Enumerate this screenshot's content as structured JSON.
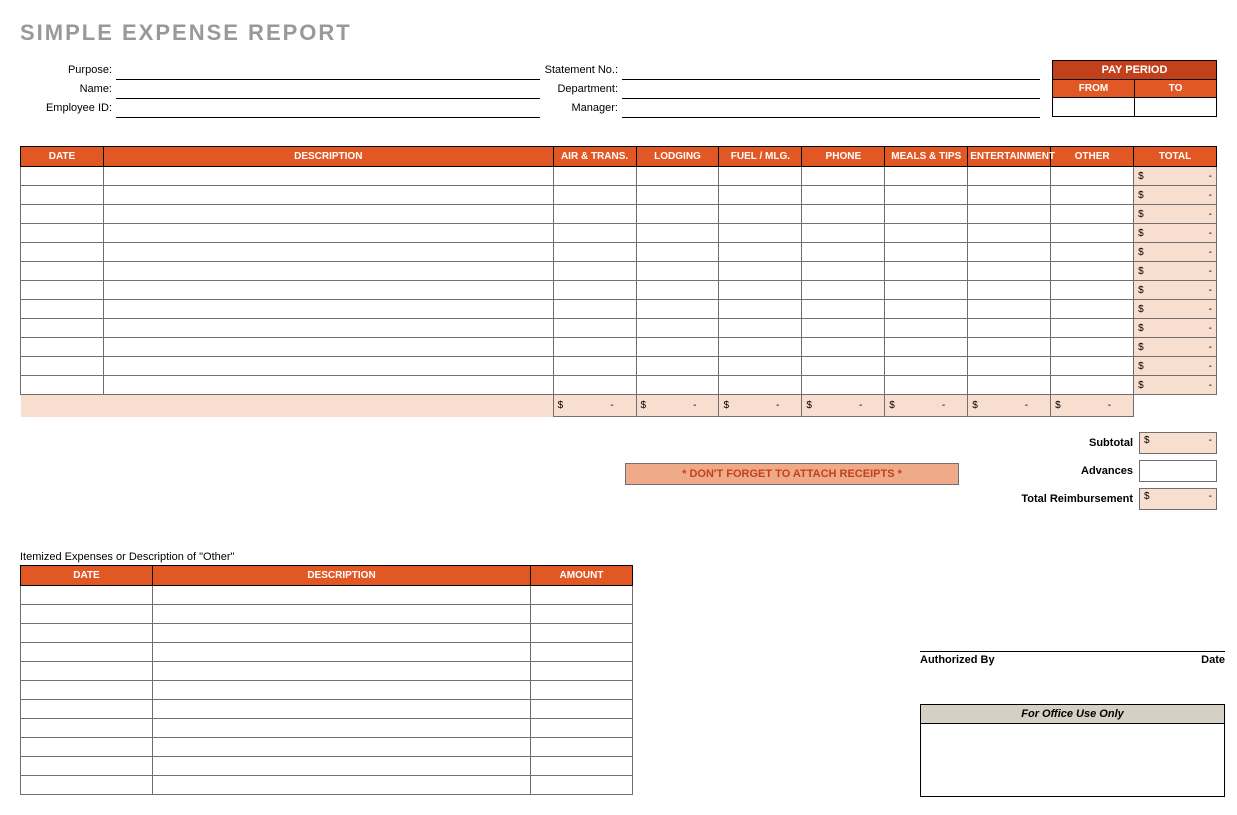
{
  "title": "SIMPLE EXPENSE REPORT",
  "fields": {
    "purpose_label": "Purpose:",
    "name_label": "Name:",
    "employee_id_label": "Employee ID:",
    "statement_no_label": "Statement No.:",
    "department_label": "Department:",
    "manager_label": "Manager:",
    "purpose": "",
    "name": "",
    "employee_id": "",
    "statement_no": "",
    "department": "",
    "manager": ""
  },
  "pay_period": {
    "title": "PAY PERIOD",
    "from_label": "FROM",
    "to_label": "TO",
    "from": "",
    "to": ""
  },
  "main_columns": {
    "date": "DATE",
    "description": "DESCRIPTION",
    "air_trans": "AIR & TRANS.",
    "lodging": "LODGING",
    "fuel_mlg": "FUEL / MLG.",
    "phone": "PHONE",
    "meals_tips": "MEALS & TIPS",
    "entertainment": "ENTERTAINMENT",
    "other": "OTHER",
    "total": "TOTAL"
  },
  "main_row_count": 12,
  "row_total_display": {
    "dollar": "$",
    "dash": "-"
  },
  "column_sum_display": {
    "dollar": "$",
    "dash": "-"
  },
  "reminder": "* DON'T FORGET TO ATTACH RECEIPTS *",
  "summary": {
    "subtotal_label": "Subtotal",
    "subtotal": {
      "dollar": "$",
      "dash": "-"
    },
    "advances_label": "Advances",
    "advances": "",
    "total_reimbursement_label": "Total Reimbursement",
    "total_reimbursement": {
      "dollar": "$",
      "dash": "-"
    }
  },
  "itemized": {
    "title": "Itemized Expenses or Description of \"Other\"",
    "columns": {
      "date": "DATE",
      "description": "DESCRIPTION",
      "amount": "AMOUNT"
    },
    "row_count": 11
  },
  "signature": {
    "authorized_by_label": "Authorized By",
    "date_label": "Date"
  },
  "office_use": {
    "title": "For Office Use Only"
  }
}
